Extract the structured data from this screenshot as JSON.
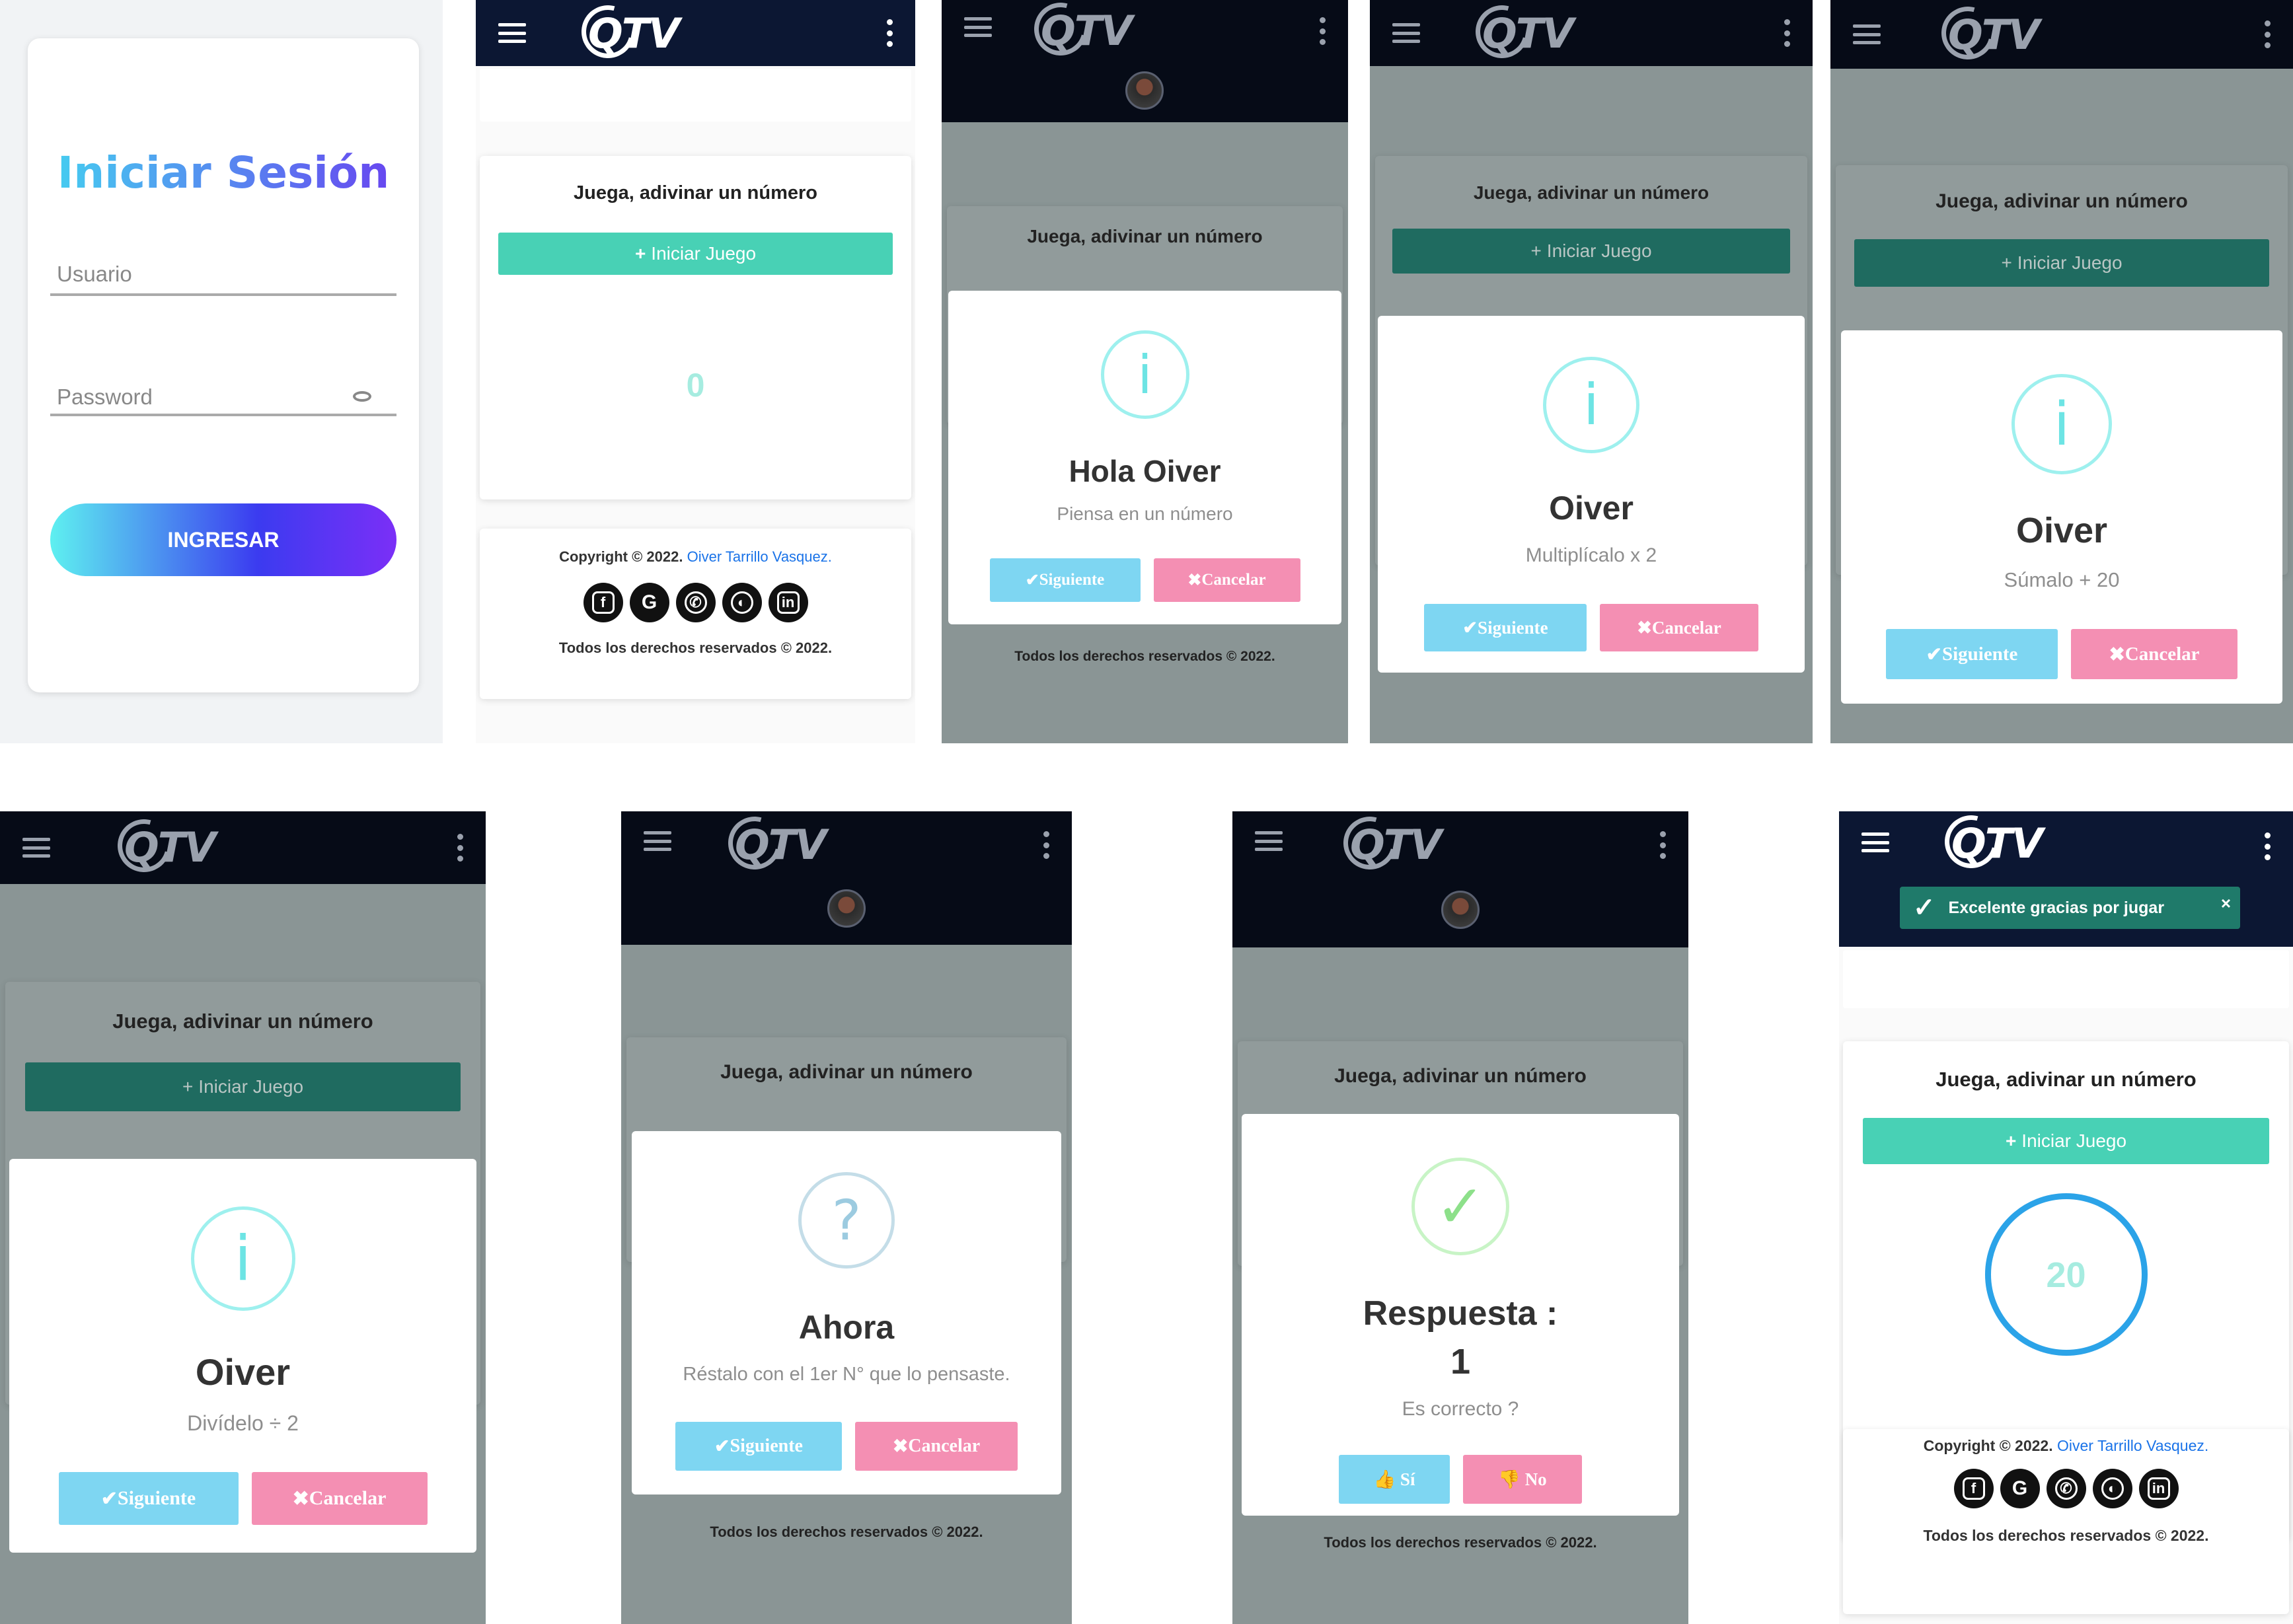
{
  "login": {
    "title": "Iniciar Sesión",
    "username_placeholder": "Usuario",
    "password_placeholder": "Password",
    "submit_label": "INGRESAR"
  },
  "app": {
    "logo_text": "QTV",
    "game_title": "Juega, adivinar un número",
    "start_label": "Iniciar Juego",
    "counter_initial": "0",
    "counter_final": "20",
    "copyright_prefix": "Copyright © 2022.",
    "copyright_author": "Oiver Tarrillo Vasquez.",
    "rights": "Todos los derechos reservados © 2022.",
    "socials": [
      "facebook-icon",
      "google-icon",
      "whatsapp-icon",
      "github-icon",
      "linkedin-icon"
    ]
  },
  "dialogs": {
    "next_label": "Siguiente",
    "cancel_label": "Cancelar",
    "step1": {
      "title": "Hola Oiver",
      "text": "Piensa en un número"
    },
    "step2": {
      "title": "Oiver",
      "text": "Multiplícalo x 2"
    },
    "step3": {
      "title": "Oiver",
      "text": "Súmalo + 20"
    },
    "step4": {
      "title": "Oiver",
      "text": "Divídelo ÷ 2"
    },
    "step5": {
      "title": "Ahora",
      "text": "Réstalo con el 1er N° que lo pensaste."
    },
    "step6": {
      "title": "Respuesta :",
      "answer": "1",
      "text": "Es correcto ?",
      "yes_label": "Sí",
      "no_label": "No"
    }
  },
  "toast": {
    "text": "Excelente gracias por jugar"
  },
  "colors": {
    "navbar": "#0c1733",
    "teal": "#48d1b5",
    "cyan": "#7ed6f2",
    "pink": "#f48fb3",
    "gradient_start": "#5ef0f0",
    "gradient_end": "#7b2ff7"
  }
}
